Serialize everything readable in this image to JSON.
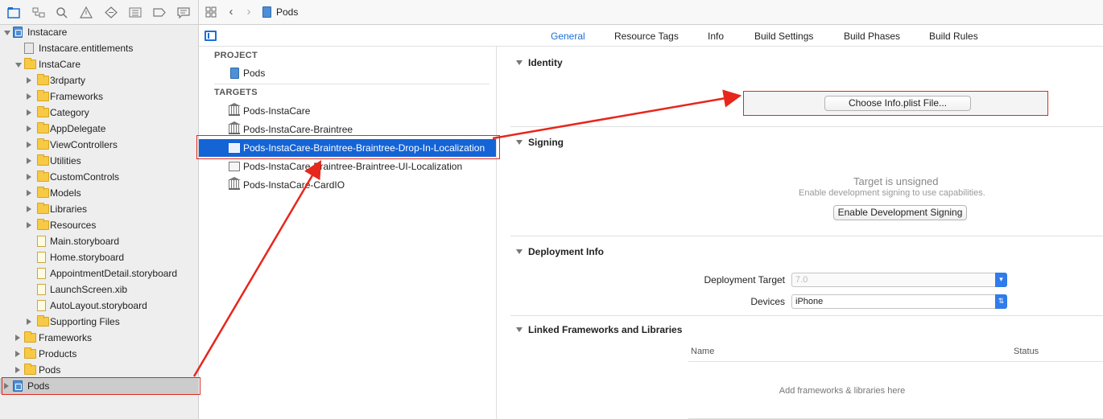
{
  "navigator": {
    "toolbar_icons": [
      "project-navigator-icon",
      "symbol-navigator-icon",
      "find-navigator-icon",
      "issue-navigator-icon",
      "test-navigator-icon",
      "debug-navigator-icon",
      "breakpoint-navigator-icon",
      "report-navigator-icon"
    ],
    "items": [
      {
        "label": "Instacare",
        "icon": "project-icon",
        "depth": 0,
        "disclosure": "open"
      },
      {
        "label": "Instacare.entitlements",
        "icon": "entitlements-file-icon",
        "depth": 1,
        "disclosure": "none"
      },
      {
        "label": "InstaCare",
        "icon": "folder-icon",
        "depth": 1,
        "disclosure": "open"
      },
      {
        "label": "3rdparty",
        "icon": "folder-icon",
        "depth": 2,
        "disclosure": "closed"
      },
      {
        "label": "Frameworks",
        "icon": "folder-icon",
        "depth": 2,
        "disclosure": "closed"
      },
      {
        "label": "Category",
        "icon": "folder-icon",
        "depth": 2,
        "disclosure": "closed"
      },
      {
        "label": "AppDelegate",
        "icon": "folder-icon",
        "depth": 2,
        "disclosure": "closed"
      },
      {
        "label": "ViewControllers",
        "icon": "folder-icon",
        "depth": 2,
        "disclosure": "closed"
      },
      {
        "label": "Utilities",
        "icon": "folder-icon",
        "depth": 2,
        "disclosure": "closed"
      },
      {
        "label": "CustomControls",
        "icon": "folder-icon",
        "depth": 2,
        "disclosure": "closed"
      },
      {
        "label": "Models",
        "icon": "folder-icon",
        "depth": 2,
        "disclosure": "closed"
      },
      {
        "label": "Libraries",
        "icon": "folder-icon",
        "depth": 2,
        "disclosure": "closed"
      },
      {
        "label": "Resources",
        "icon": "folder-icon",
        "depth": 2,
        "disclosure": "closed"
      },
      {
        "label": "Main.storyboard",
        "icon": "storyboard-file-icon",
        "depth": 2,
        "disclosure": "none"
      },
      {
        "label": "Home.storyboard",
        "icon": "storyboard-file-icon",
        "depth": 2,
        "disclosure": "none"
      },
      {
        "label": "AppointmentDetail.storyboard",
        "icon": "storyboard-file-icon",
        "depth": 2,
        "disclosure": "none"
      },
      {
        "label": "LaunchScreen.xib",
        "icon": "xib-file-icon",
        "depth": 2,
        "disclosure": "none"
      },
      {
        "label": "AutoLayout.storyboard",
        "icon": "storyboard-file-icon",
        "depth": 2,
        "disclosure": "none"
      },
      {
        "label": "Supporting Files",
        "icon": "folder-icon",
        "depth": 2,
        "disclosure": "closed"
      },
      {
        "label": "Frameworks",
        "icon": "folder-icon",
        "depth": 1,
        "disclosure": "closed"
      },
      {
        "label": "Products",
        "icon": "folder-icon",
        "depth": 1,
        "disclosure": "closed"
      },
      {
        "label": "Pods",
        "icon": "folder-icon",
        "depth": 1,
        "disclosure": "closed"
      },
      {
        "label": "Pods",
        "icon": "project-icon",
        "depth": 0,
        "disclosure": "closed",
        "selected": true
      }
    ]
  },
  "editor": {
    "breadcrumb": "Pods",
    "tabs": [
      {
        "label": "General",
        "active": true
      },
      {
        "label": "Resource Tags",
        "active": false
      },
      {
        "label": "Info",
        "active": false
      },
      {
        "label": "Build Settings",
        "active": false
      },
      {
        "label": "Build Phases",
        "active": false
      },
      {
        "label": "Build Rules",
        "active": false
      }
    ]
  },
  "targets_list": {
    "project_header": "PROJECT",
    "project_item": "Pods",
    "targets_header": "TARGETS",
    "targets": [
      {
        "label": "Pods-InstaCare",
        "icon": "library-target-icon",
        "selected": false
      },
      {
        "label": "Pods-InstaCare-Braintree",
        "icon": "library-target-icon",
        "selected": false
      },
      {
        "label": "Pods-InstaCare-Braintree-Braintree-Drop-In-Localization",
        "icon": "bundle-target-icon",
        "selected": true
      },
      {
        "label": "Pods-InstaCare-Braintree-Braintree-UI-Localization",
        "icon": "bundle-target-icon",
        "selected": false
      },
      {
        "label": "Pods-InstaCare-CardIO",
        "icon": "library-target-icon",
        "selected": false
      }
    ]
  },
  "settings": {
    "identity": {
      "title": "Identity",
      "choose_plist_label": "Choose Info.plist File..."
    },
    "signing": {
      "title": "Signing",
      "unsigned_title": "Target is unsigned",
      "unsigned_subtitle": "Enable development signing to use capabilities.",
      "enable_button": "Enable Development Signing"
    },
    "deployment": {
      "title": "Deployment Info",
      "target_label": "Deployment Target",
      "target_value": "7.0",
      "devices_label": "Devices",
      "devices_value": "iPhone"
    },
    "frameworks": {
      "title": "Linked Frameworks and Libraries",
      "col_name": "Name",
      "col_status": "Status",
      "empty_text": "Add frameworks & libraries here"
    }
  },
  "colors": {
    "selection_blue": "#1464d6",
    "accent_blue": "#1a6fd8",
    "annotation_red": "#e0281e",
    "folder_yellow": "#f7c944"
  }
}
